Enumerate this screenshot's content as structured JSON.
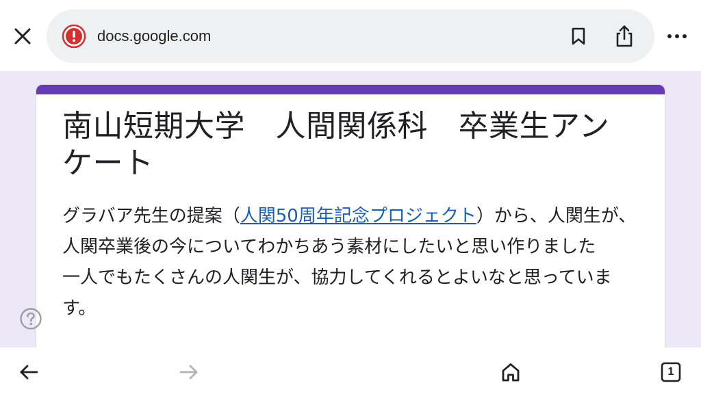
{
  "browser": {
    "url": "docs.google.com",
    "tab_count": "1"
  },
  "form": {
    "title": "南山短期大学　人間関係科　卒業生アンケート",
    "desc_before_link": "グラバア先生の提案（",
    "desc_link": "人関50周年記念プロジェクト",
    "desc_after_link": "）から、人関生が、人関卒業後の今についてわかちあう素材にしたいと思い作りました",
    "desc_line2": "一人でもたくさんの人関生が、協力してくれるとよいなと思っています。"
  },
  "icons": {
    "close": "close-icon",
    "site_warning": "warning-icon",
    "bookmark": "bookmark-icon",
    "share": "share-icon",
    "more": "more-icon",
    "help": "help-icon",
    "back": "back-arrow-icon",
    "forward": "forward-arrow-icon",
    "home": "home-icon",
    "tabs": "tabs-icon"
  },
  "colors": {
    "accent": "#673ab7",
    "page_background": "#ede7f6",
    "link": "#1a5fb4",
    "warning_red": "#d32f2f"
  }
}
